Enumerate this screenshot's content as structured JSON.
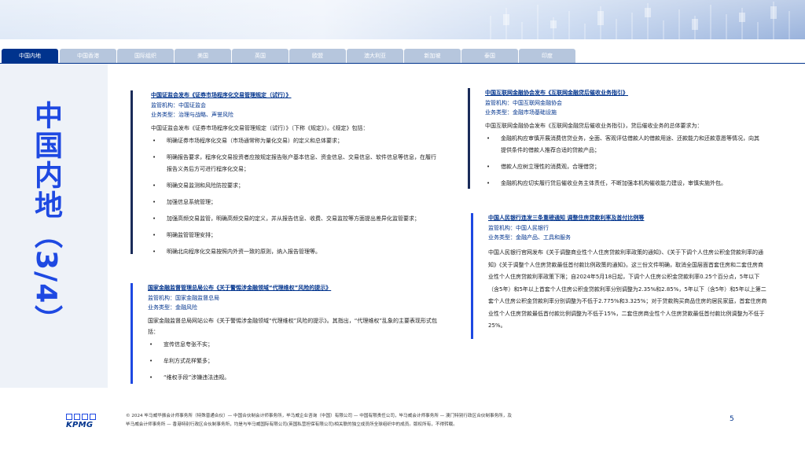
{
  "tabs": [
    "中国内地",
    "中国香港",
    "国际组织",
    "美国",
    "英国",
    "欧盟",
    "澳大利亚",
    "新加坡",
    "泰国",
    "印度"
  ],
  "active_tab_index": 0,
  "side_title": "中国内地（3/4）",
  "sections": {
    "s1": {
      "title": "中国证监会发布《证券市场程序化交易管理规定（试行）》",
      "regulator": "监管机构：中国证监会",
      "category": "业务类型：治理与战略、声誉风险",
      "intro": "中国证监会发布《证券市场程序化交易管理规定（试行）》（下称《规定》）。《规定》包括：",
      "bullets": [
        "明确证券市场程序化交易（市场通常称为量化交易）的定义和总体要求；",
        "明确报告要求，程序化交易投资者应按规定报告账户基本信息、资金信息、交易信息、软件信息等信息，在履行报告义务后方可进行程序化交易；",
        "明确交易监测和风险防控要求；",
        "加强信息系统管理；",
        "加强高频交易监管，明确高频交易的定义，并从报告信息、收费、交易监控等方面提出差异化监管要求；",
        "明确监管管理安排；",
        "明确北向程序化交易按照内外资一致的原则，纳入报告管理等。"
      ]
    },
    "s2": {
      "title": "国家金融监督管理总局公布《关于警惕涉金融领域“代理维权”风险的提示》",
      "regulator": "监管机构：国家金融监督总局",
      "category": "业务类型：金融风险",
      "intro": "国家金融监督总局网站公布《关于警惕涉金融领域“代理维权”风险的提示》。其指出，“代理维权”乱象的主要表现形式包括：",
      "bullets": [
        "宣传信息夸张不实；",
        "牟利方式花样繁多；",
        "“维权手段”涉嫌违法违规。"
      ]
    },
    "s3": {
      "title": "中国互联网金融协会发布《互联网金融贷后催收业务指引》",
      "regulator": "监管机构：中国互联网金融协会",
      "category": "业务类型：金融市场基础设施",
      "intro": "中国互联网金融协会发布《互联网金融贷后催收业务指引》，贷后催收业务的总体要求为：",
      "bullets": [
        "金融机构应审慎开展消费信贷业务，全面、客观评估借款人的借款用途、还款能力和还款意愿等情况，向其提供条件的借款人推荐合适的贷款产品；",
        "借款人应树立理性的消费观，合理借贷；",
        "金融机构应切实履行贷后催收业务主体责任，不断加强本机构催收能力建设，审慎实施外包。"
      ]
    },
    "s4": {
      "title": "中国人民银行连发三条重磅通知 调整住房贷款利率及首付比例等",
      "regulator": "监管机构：中国人民银行",
      "category": "业务类型：金融产品、工具和服务",
      "body": "中国人民银行官网发布《关于调整商业性个人住房贷款利率政策的通知》、《关于下调个人住房公积金贷款利率的通知》《关于调整个人住房贷款最低首付款比例政策的通知》。这三份文件明确，取消全国层面首套住房和二套住房商业性个人住房贷款利率政策下限；自2024年5月18日起，下调个人住房公积金贷款利率0.25个百分点，5年以下（含5年）和5年以上首套个人住房公积金贷款利率分别调整为2.35%和2.85%，5年以下（含5年）和5年以上第二套个人住房公积金贷款利率分别调整为不低于2.775%和3.325%；对于贷款购买商品住房的居民家庭，首套住房商业性个人住房贷款最低首付款比例调整为不低于15%，二套住房商业性个人住房贷款最低首付款比例调整为不低于25%。"
    }
  },
  "footer": {
    "line1": "© 2024 毕马威华振会计师事务所（特殊普通合伙）— 中国合伙制会计师事务所，毕马威企业咨询（中国）有限公司 — 中国有限责任公司，毕马威会计师事务所 — 澳门特别行政区合伙制事务所，及",
    "line2": "毕马威会计师事务所 — 香港特别行政区合伙制事务所，均是与毕马威国际有限公司(英国私营担保有限公司)相关联的独立成员所全球组织中的成员。版权所有，不得转载。",
    "logo_text": "KPMG",
    "page_number": "5"
  },
  "colors": {
    "kpmg_blue": "#00338d",
    "title_blue": "#1e49e2",
    "tab_inactive": "#b6c6dd",
    "panel": "#eef2f8"
  }
}
